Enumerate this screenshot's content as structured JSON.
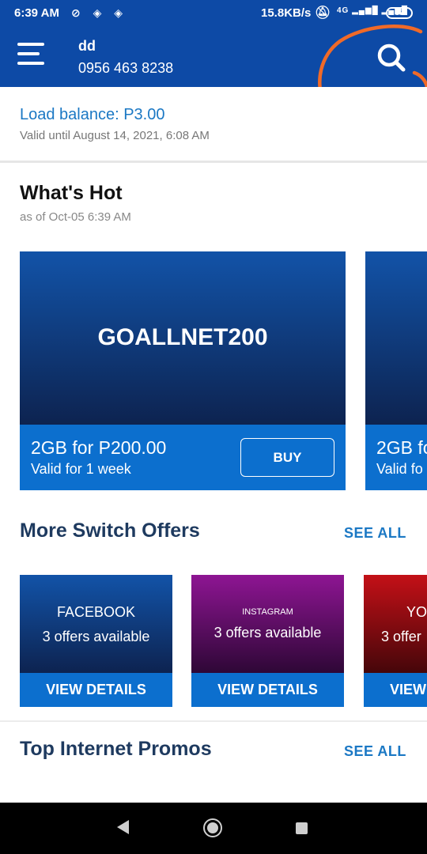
{
  "status_bar": {
    "time": "6:39 AM",
    "left_icons": "⊘ ◈ ◈",
    "net_speed": "15.8KB/s",
    "bell_icon": "bell-off-icon",
    "signal": "4G ▂▄▆█ ▂▄▆█",
    "battery": "37"
  },
  "header": {
    "account_name": "dd",
    "account_number": "0956 463 8238"
  },
  "balance": {
    "label": "Load balance: P3.00",
    "valid_until": "Valid until August 14, 2021, 6:08 AM"
  },
  "whats_hot": {
    "title": "What's Hot",
    "as_of": "as of Oct-05 6:39 AM",
    "cards": [
      {
        "code": "GOALLNET200",
        "price": "2GB for P200.00",
        "validity": "Valid for 1 week",
        "button": "BUY"
      },
      {
        "code": "",
        "price": "2GB fo",
        "validity": "Valid fo",
        "button": ""
      }
    ]
  },
  "switch_offers": {
    "title": "More Switch Offers",
    "see_all": "SEE ALL",
    "cards": [
      {
        "name": "FACEBOOK",
        "count": "3 offers available",
        "button": "VIEW DETAILS"
      },
      {
        "name": "INSTAGRAM",
        "count": "3 offers available",
        "button": "VIEW DETAILS"
      },
      {
        "name": "YO",
        "count": "3 offer",
        "button": "VIEW"
      }
    ]
  },
  "top_promos": {
    "title": "Top Internet Promos",
    "see_all": "SEE ALL"
  },
  "colors": {
    "primary": "#0d4aa6",
    "accent_blue": "#0c6fce",
    "annotation_orange": "#f06a28"
  }
}
